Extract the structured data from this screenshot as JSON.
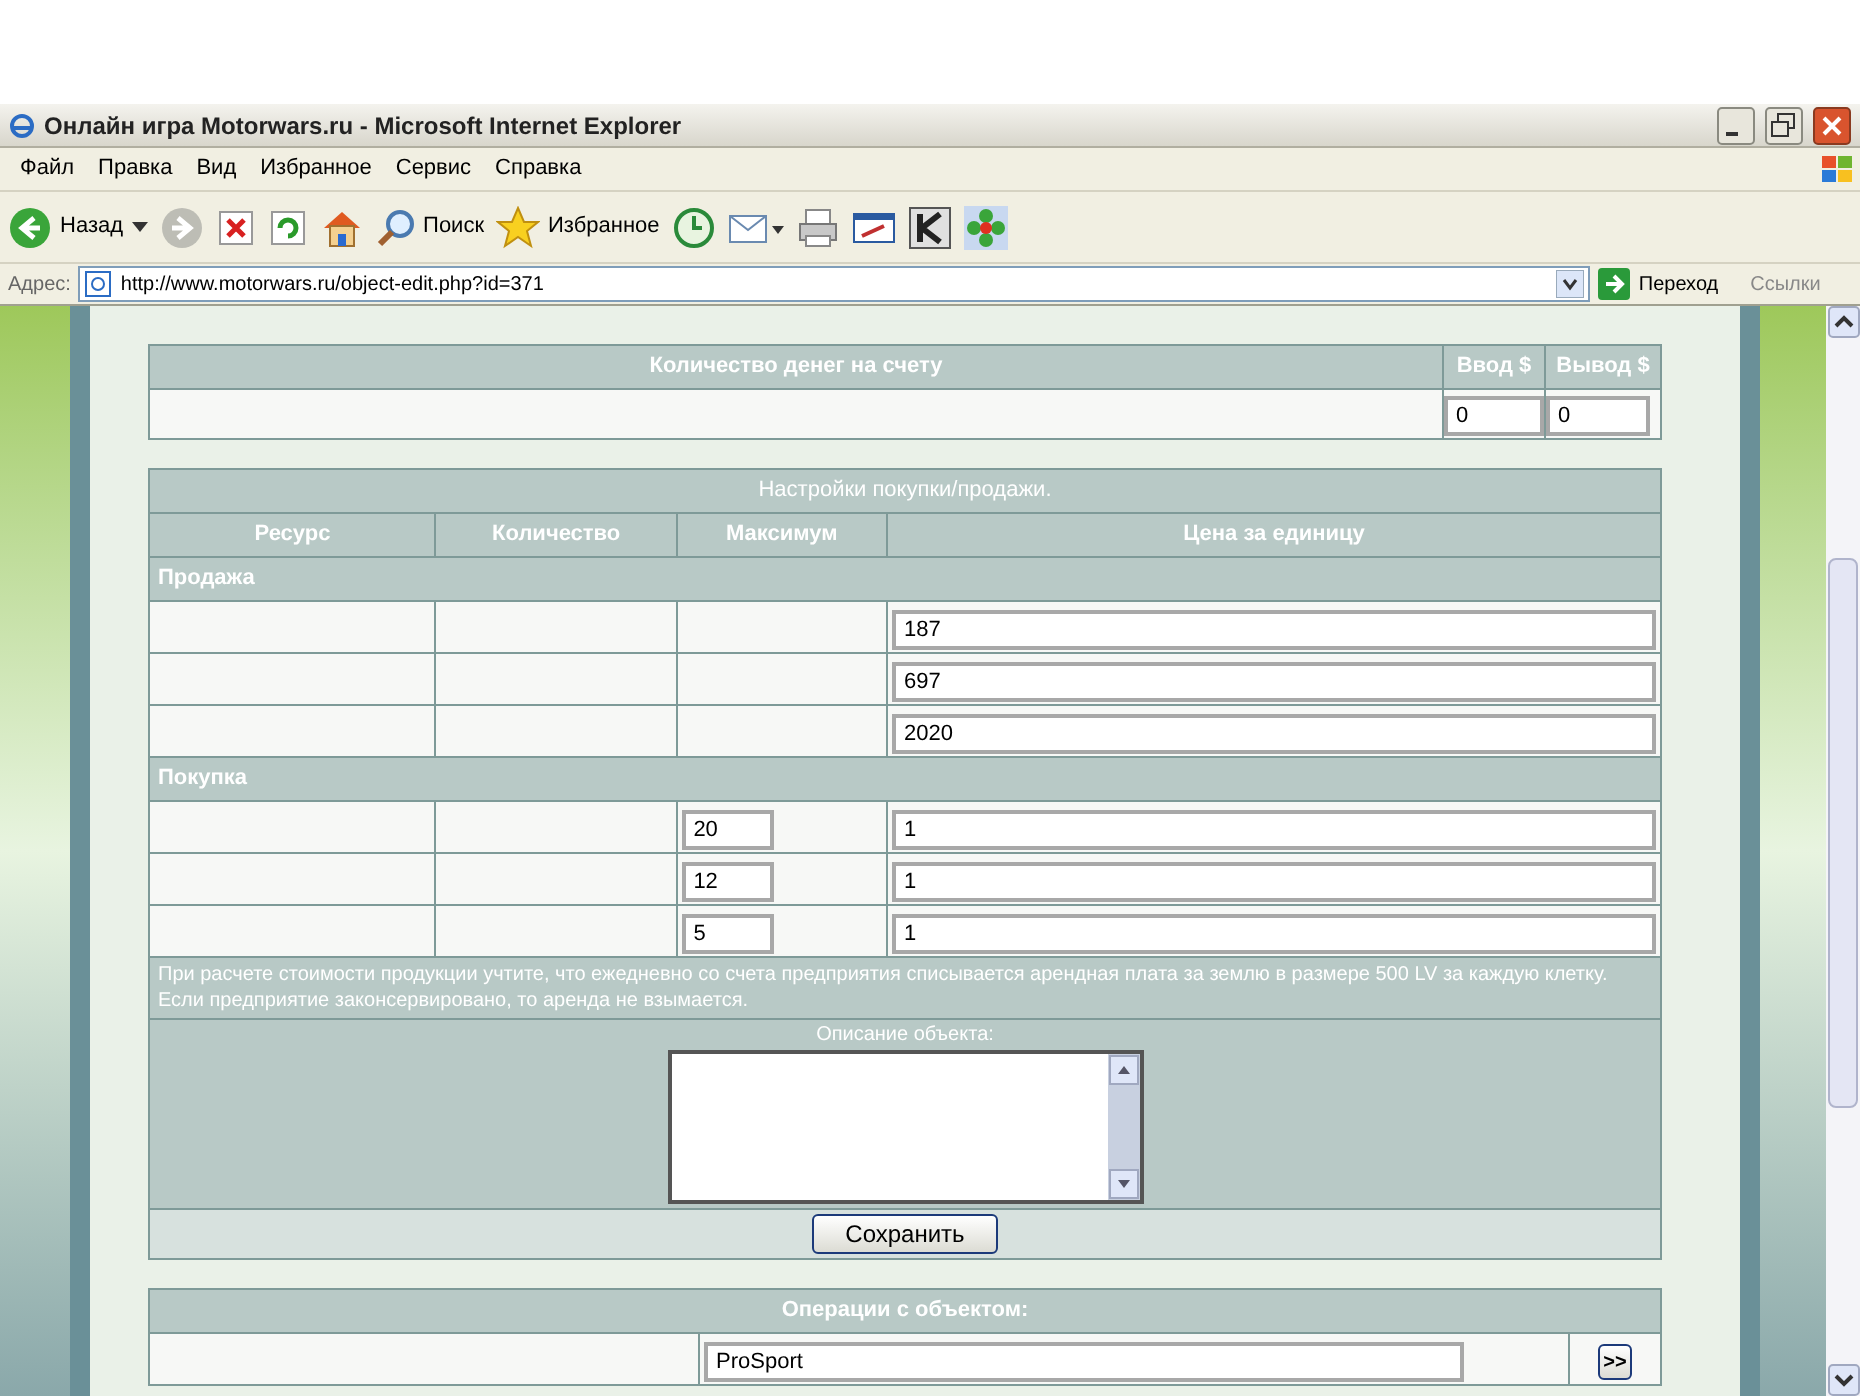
{
  "window": {
    "title": "Онлайн игра Motorwars.ru - Microsoft Internet Explorer"
  },
  "menu": [
    "Файл",
    "Правка",
    "Вид",
    "Избранное",
    "Сервис",
    "Справка"
  ],
  "toolbar": {
    "back": "Назад",
    "search": "Поиск",
    "favorites": "Избранное"
  },
  "address_bar": {
    "label": "Адрес:",
    "url": "http://www.motorwars.ru/object-edit.php?id=371",
    "go": "Переход",
    "links": "Ссылки"
  },
  "money": {
    "title": "Количество денег на счету",
    "deposit_label": "Ввод $",
    "withdraw_label": "Вывод $",
    "deposit": "0",
    "withdraw": "0"
  },
  "trade": {
    "title": "Настройки покупки/продажи.",
    "columns": [
      "Ресурс",
      "Количество",
      "Максимум",
      "Цена за единицу"
    ],
    "sections": [
      {
        "title": "Продажа",
        "rows": [
          {
            "price": "187"
          },
          {
            "price": "697"
          },
          {
            "price": "2020"
          }
        ]
      },
      {
        "title": "Покупка",
        "rows": [
          {
            "maximum": "20",
            "price": "1"
          },
          {
            "maximum": "12",
            "price": "1"
          },
          {
            "maximum": "5",
            "price": "1"
          }
        ]
      }
    ],
    "note": "При расчете стоимости продукции учтите, что ежедневно со счета предприятия списывается арендная плата за землю в размере 500 LV за каждую клетку. Если предприятие законсервировано, то аренда не взымается.",
    "description_label": "Описание объекта:",
    "save": "Сохранить"
  },
  "operations": {
    "title": "Операции с объектом:",
    "value": "ProSport",
    "go": ">>"
  }
}
